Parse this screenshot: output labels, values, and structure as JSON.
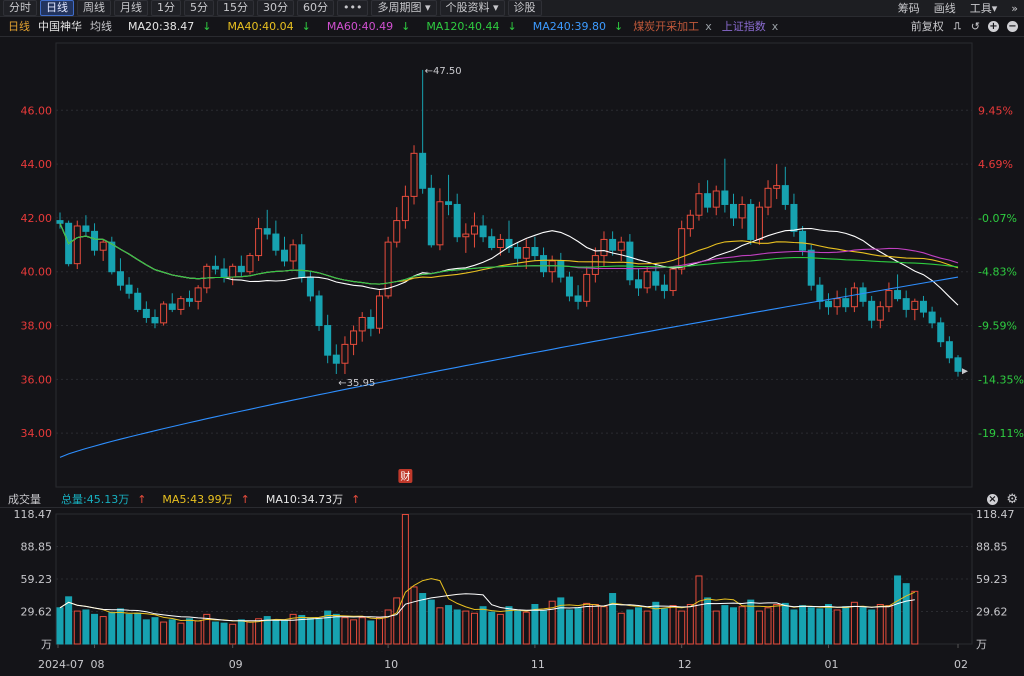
{
  "toolbar": {
    "tabs": [
      "分时",
      "日线",
      "周线",
      "月线",
      "1分",
      "5分",
      "15分",
      "30分",
      "60分"
    ],
    "more_label": "•••",
    "multi_period_label": "多周期图",
    "stock_info_label": "个股资料",
    "diagnose_label": "诊股",
    "right": {
      "chip": "筹码",
      "draw": "画线",
      "tools": "工具"
    }
  },
  "info": {
    "period": "日线",
    "name": "中国神华",
    "avg_label": "均线",
    "ma20": "MA20:38.47",
    "ma40": "MA40:40.04",
    "ma60": "MA60:40.49",
    "ma120": "MA120:40.44",
    "ma240": "MA240:39.80",
    "overlay1": "煤炭开采加工",
    "overlay2": "上证指数",
    "close_x": "x",
    "adjust_label": "前复权"
  },
  "colors": {
    "up": "#e74c3c",
    "down": "#17a2b0",
    "ma20": "#ffffff",
    "ma40": "#e8c020",
    "ma60": "#c040c0",
    "ma120": "#2ecc40",
    "ma240": "#2e8fff",
    "grid": "#2a2b30",
    "price_up_label": "#e83a3a",
    "price_down_label": "#2ecc40"
  },
  "chart_data": [
    {
      "type": "candlestick",
      "title": "中国神华 日线",
      "y_ticks": [
        "46.00",
        "44.00",
        "42.00",
        "40.00",
        "38.00",
        "36.00",
        "34.00"
      ],
      "pct_ticks": [
        "9.45%",
        "4.69%",
        "-0.07%",
        "-4.83%",
        "-9.59%",
        "-14.35%",
        "-19.11%"
      ],
      "ylim": [
        32.0,
        48.5
      ],
      "annotations": {
        "high": "47.50",
        "low": "35.95",
        "event": "财"
      },
      "candles": [
        [
          41.9,
          42.2,
          41.6,
          41.8
        ],
        [
          41.8,
          41.9,
          40.2,
          40.3
        ],
        [
          40.3,
          41.9,
          40.1,
          41.7
        ],
        [
          41.7,
          42.1,
          41.3,
          41.5
        ],
        [
          41.5,
          41.8,
          40.6,
          40.8
        ],
        [
          40.8,
          41.2,
          40.4,
          41.1
        ],
        [
          41.1,
          41.3,
          39.9,
          40.0
        ],
        [
          40.0,
          40.5,
          39.3,
          39.5
        ],
        [
          39.5,
          39.8,
          39.0,
          39.2
        ],
        [
          39.2,
          39.4,
          38.5,
          38.6
        ],
        [
          38.6,
          38.9,
          38.1,
          38.3
        ],
        [
          38.3,
          38.6,
          37.9,
          38.1
        ],
        [
          38.1,
          38.9,
          38.0,
          38.8
        ],
        [
          38.8,
          39.2,
          38.5,
          38.6
        ],
        [
          38.6,
          39.1,
          38.4,
          39.0
        ],
        [
          39.0,
          39.3,
          38.7,
          38.9
        ],
        [
          38.9,
          39.5,
          38.6,
          39.4
        ],
        [
          39.4,
          40.3,
          39.2,
          40.2
        ],
        [
          40.2,
          40.6,
          39.9,
          40.1
        ],
        [
          40.1,
          40.5,
          39.6,
          39.8
        ],
        [
          39.8,
          40.3,
          39.5,
          40.2
        ],
        [
          40.2,
          40.6,
          39.8,
          40.0
        ],
        [
          40.0,
          40.7,
          39.9,
          40.6
        ],
        [
          40.6,
          42.0,
          40.4,
          41.6
        ],
        [
          41.6,
          42.3,
          41.2,
          41.4
        ],
        [
          41.4,
          41.9,
          40.6,
          40.8
        ],
        [
          40.8,
          41.3,
          40.2,
          40.4
        ],
        [
          40.4,
          41.2,
          40.1,
          41.0
        ],
        [
          41.0,
          41.4,
          39.6,
          39.8
        ],
        [
          39.8,
          40.0,
          38.9,
          39.1
        ],
        [
          39.1,
          39.3,
          37.8,
          38.0
        ],
        [
          38.0,
          38.4,
          36.6,
          36.9
        ],
        [
          36.9,
          37.3,
          36.2,
          36.6
        ],
        [
          36.6,
          37.6,
          36.2,
          37.3
        ],
        [
          37.3,
          38.0,
          36.9,
          37.8
        ],
        [
          37.8,
          38.5,
          37.4,
          38.3
        ],
        [
          38.3,
          38.6,
          37.6,
          37.9
        ],
        [
          37.9,
          39.3,
          37.7,
          39.1
        ],
        [
          39.1,
          41.3,
          39.0,
          41.1
        ],
        [
          41.1,
          42.4,
          40.9,
          41.9
        ],
        [
          41.9,
          43.2,
          41.6,
          42.8
        ],
        [
          42.8,
          44.7,
          42.5,
          44.4
        ],
        [
          44.4,
          47.5,
          42.9,
          43.1
        ],
        [
          43.1,
          43.6,
          40.9,
          41.0
        ],
        [
          41.0,
          43.1,
          40.8,
          42.6
        ],
        [
          42.6,
          43.6,
          42.1,
          42.5
        ],
        [
          42.5,
          42.9,
          41.1,
          41.3
        ],
        [
          41.3,
          41.8,
          40.7,
          41.4
        ],
        [
          41.4,
          42.2,
          40.9,
          41.7
        ],
        [
          41.7,
          42.1,
          41.1,
          41.3
        ],
        [
          41.3,
          41.6,
          40.8,
          40.9
        ],
        [
          40.9,
          41.4,
          40.6,
          41.2
        ],
        [
          41.2,
          41.9,
          40.7,
          40.9
        ],
        [
          40.9,
          41.1,
          40.2,
          40.5
        ],
        [
          40.5,
          41.2,
          40.1,
          40.9
        ],
        [
          40.9,
          41.3,
          40.4,
          40.6
        ],
        [
          40.6,
          40.9,
          39.8,
          40.0
        ],
        [
          40.0,
          40.6,
          39.6,
          40.4
        ],
        [
          40.4,
          40.7,
          39.6,
          39.8
        ],
        [
          39.8,
          40.0,
          38.9,
          39.1
        ],
        [
          39.1,
          39.5,
          38.6,
          38.9
        ],
        [
          38.9,
          40.2,
          38.7,
          39.9
        ],
        [
          39.9,
          40.9,
          39.6,
          40.6
        ],
        [
          40.6,
          41.5,
          40.2,
          41.2
        ],
        [
          41.2,
          41.5,
          40.6,
          40.8
        ],
        [
          40.8,
          41.3,
          40.4,
          41.1
        ],
        [
          41.1,
          41.4,
          39.5,
          39.7
        ],
        [
          39.7,
          40.1,
          39.1,
          39.4
        ],
        [
          39.4,
          40.2,
          39.2,
          40.0
        ],
        [
          40.0,
          40.3,
          39.3,
          39.5
        ],
        [
          39.5,
          39.9,
          39.0,
          39.3
        ],
        [
          39.3,
          40.2,
          39.1,
          40.1
        ],
        [
          40.1,
          41.9,
          39.9,
          41.6
        ],
        [
          41.6,
          42.3,
          41.3,
          42.1
        ],
        [
          42.1,
          43.3,
          41.9,
          42.9
        ],
        [
          42.9,
          43.4,
          42.2,
          42.4
        ],
        [
          42.4,
          43.2,
          42.1,
          43.0
        ],
        [
          43.0,
          44.2,
          42.2,
          42.5
        ],
        [
          42.5,
          42.9,
          41.7,
          42.0
        ],
        [
          42.0,
          42.8,
          41.6,
          42.5
        ],
        [
          42.5,
          42.7,
          41.0,
          41.2
        ],
        [
          41.2,
          42.6,
          41.0,
          42.4
        ],
        [
          42.4,
          43.4,
          42.1,
          43.1
        ],
        [
          43.1,
          44.0,
          42.7,
          43.2
        ],
        [
          43.2,
          43.9,
          42.3,
          42.5
        ],
        [
          42.5,
          42.9,
          41.3,
          41.5
        ],
        [
          41.5,
          41.7,
          40.6,
          40.8
        ],
        [
          40.8,
          41.0,
          39.3,
          39.5
        ],
        [
          39.5,
          39.8,
          38.6,
          38.9
        ],
        [
          38.9,
          39.2,
          38.4,
          38.7
        ],
        [
          38.7,
          39.3,
          38.4,
          39.0
        ],
        [
          39.0,
          39.4,
          38.5,
          38.7
        ],
        [
          38.7,
          39.6,
          38.5,
          39.4
        ],
        [
          39.4,
          39.6,
          38.7,
          38.9
        ],
        [
          38.9,
          39.1,
          37.9,
          38.2
        ],
        [
          38.2,
          38.9,
          37.9,
          38.7
        ],
        [
          38.7,
          39.6,
          38.5,
          39.3
        ],
        [
          39.3,
          39.9,
          38.9,
          39.0
        ],
        [
          39.0,
          39.3,
          38.3,
          38.6
        ],
        [
          38.6,
          39.0,
          38.2,
          38.9
        ],
        [
          38.9,
          39.1,
          38.3,
          38.5
        ],
        [
          38.5,
          38.7,
          37.9,
          38.1
        ],
        [
          38.1,
          38.3,
          37.2,
          37.4
        ],
        [
          37.4,
          37.6,
          36.6,
          36.8
        ],
        [
          36.8,
          36.9,
          36.1,
          36.3
        ]
      ],
      "volumes": [
        33,
        43,
        30,
        31,
        27,
        25,
        29,
        32,
        27,
        28,
        22,
        24,
        20,
        22,
        19,
        23,
        21,
        27,
        20,
        19,
        18,
        22,
        20,
        23,
        25,
        22,
        21,
        27,
        26,
        24,
        23,
        30,
        27,
        24,
        22,
        24,
        21,
        24,
        31,
        42,
        118,
        52,
        46,
        40,
        33,
        35,
        31,
        30,
        28,
        34,
        29,
        27,
        34,
        31,
        29,
        36,
        30,
        39,
        42,
        31,
        33,
        37,
        36,
        34,
        46,
        28,
        31,
        33,
        30,
        38,
        32,
        35,
        30,
        36,
        62,
        42,
        30,
        35,
        33,
        34,
        40,
        30,
        33,
        36,
        37,
        31,
        35,
        33,
        32,
        36,
        31,
        34,
        38,
        33,
        31,
        36,
        35,
        62,
        55,
        48
      ],
      "vol_ticks": [
        "118.47",
        "88.85",
        "59.23",
        "29.62",
        "万"
      ],
      "x_labels": [
        "2024-07",
        "08",
        "09",
        "10",
        "11",
        "12",
        "01",
        "02"
      ]
    }
  ],
  "volume_header": {
    "title": "成交量",
    "total": "总量:45.13万",
    "ma5": "MA5:43.99万",
    "ma10": "MA10:34.73万"
  }
}
